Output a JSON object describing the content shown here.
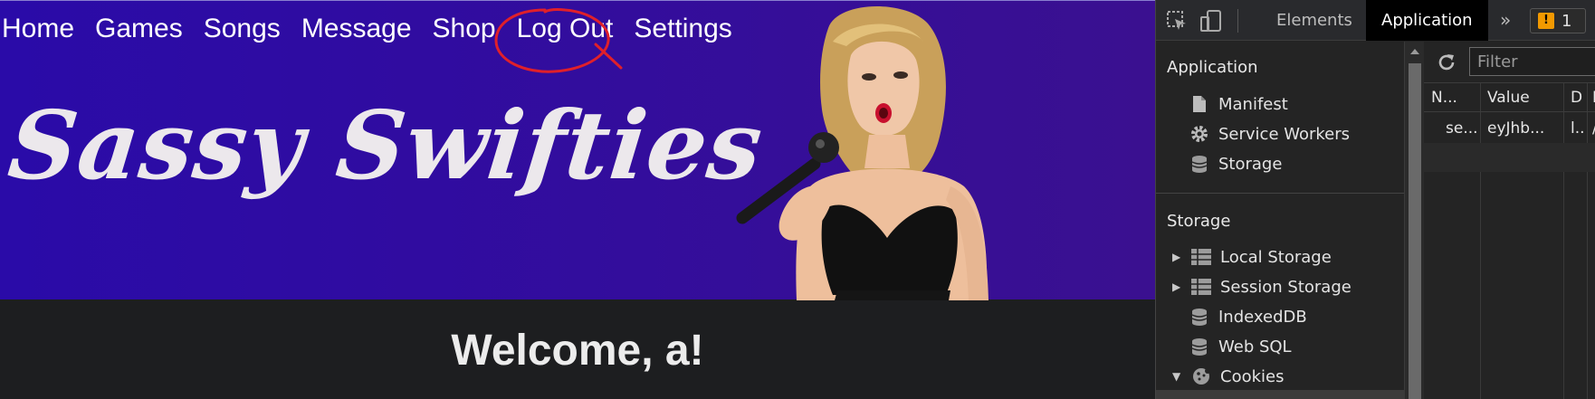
{
  "nav": {
    "items": [
      "Home",
      "Games",
      "Songs",
      "Message",
      "Shop",
      "Log Out",
      "Settings"
    ]
  },
  "site": {
    "title": "Sassy Swifties",
    "welcome": "Welcome, a!"
  },
  "colors": {
    "banner": "#2a0ba8",
    "page_bg": "#1d1e20",
    "annotation_circle": "#e0202a",
    "devtools_bg": "#242424"
  },
  "devtools": {
    "tabs": [
      "Elements",
      "Application"
    ],
    "active_tab": "Application",
    "issues_count": "1",
    "sidebar": {
      "application_section": "Application",
      "application_items": [
        "Manifest",
        "Service Workers",
        "Storage"
      ],
      "storage_section": "Storage",
      "storage_items": [
        "Local Storage",
        "Session Storage",
        "IndexedDB",
        "Web SQL",
        "Cookies"
      ]
    },
    "filter_placeholder": "Filter",
    "table": {
      "columns": [
        "N...",
        "Value",
        "D",
        "P"
      ],
      "rows": [
        [
          "se...",
          "eyJhb...",
          "l...",
          "/"
        ]
      ]
    }
  }
}
